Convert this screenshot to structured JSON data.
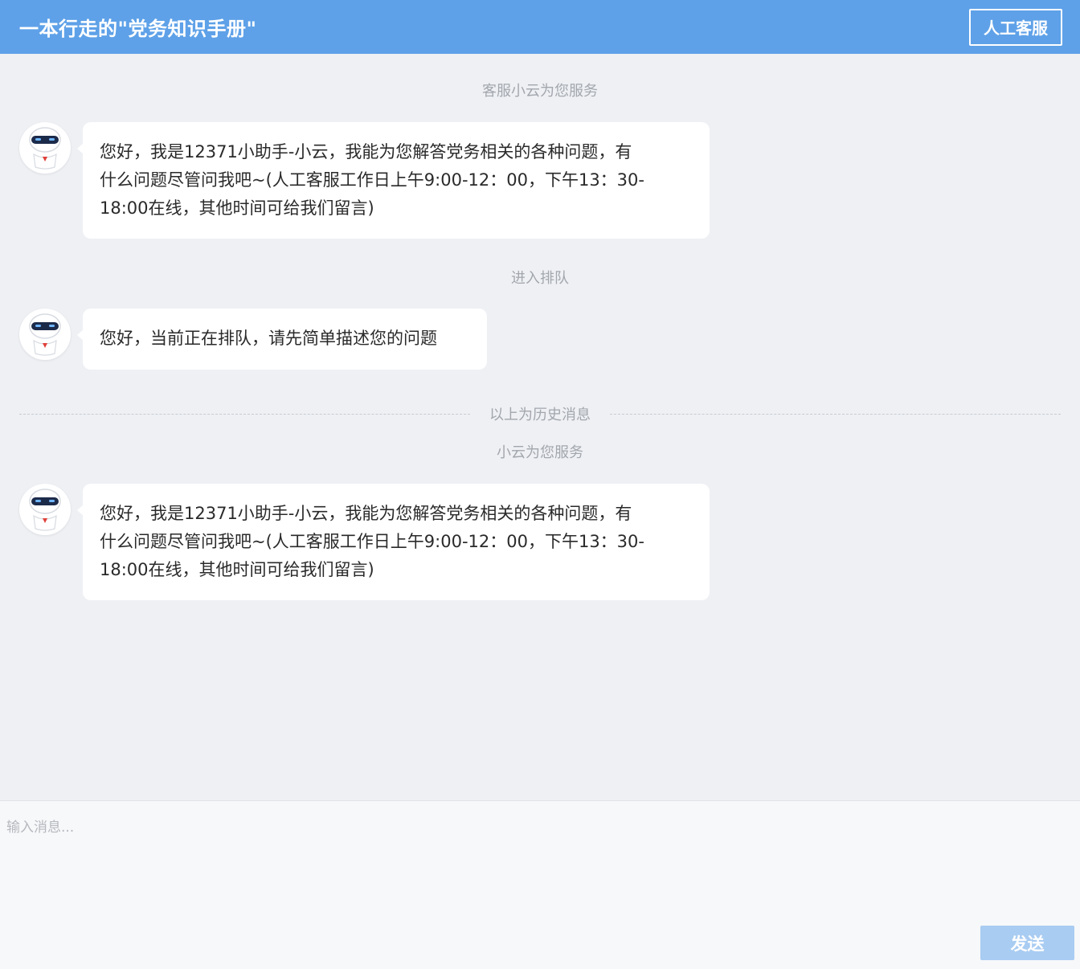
{
  "header": {
    "title": "一本行走的\"党务知识手册\"",
    "human_service_label": "人工客服"
  },
  "chat": {
    "system_messages": [
      "客服小云为您服务",
      "进入排队",
      "小云为您服务"
    ],
    "history_divider_label": "以上为历史消息",
    "messages": [
      {
        "sender": "robot-avatar",
        "lines": [
          "您好，我是12371小助手-小云，我能为您解答党务相关的各种问题，有",
          "什么问题尽管问我吧~(人工客服工作日上午9:00-12：00，下午13：30-",
          "18:00在线，其他时间可给我们留言)"
        ]
      },
      {
        "sender": "robot-avatar",
        "lines": [
          "您好，当前正在排队，请先简单描述您的问题"
        ]
      },
      {
        "sender": "robot-avatar",
        "lines": [
          "您好，我是12371小助手-小云，我能为您解答党务相关的各种问题，有",
          "什么问题尽管问我吧~(人工客服工作日上午9:00-12：00，下午13：30-",
          "18:00在线，其他时间可给我们留言)"
        ]
      }
    ]
  },
  "input": {
    "value": "",
    "placeholder": "输入消息...",
    "send_label": "发送"
  },
  "colors": {
    "header_bg": "#5ea1e8",
    "chat_bg": "#eef0f4",
    "send_button_bg": "#a9ccf2",
    "avatar_visor": "#1c2a4a",
    "avatar_badge": "#e0403a"
  }
}
